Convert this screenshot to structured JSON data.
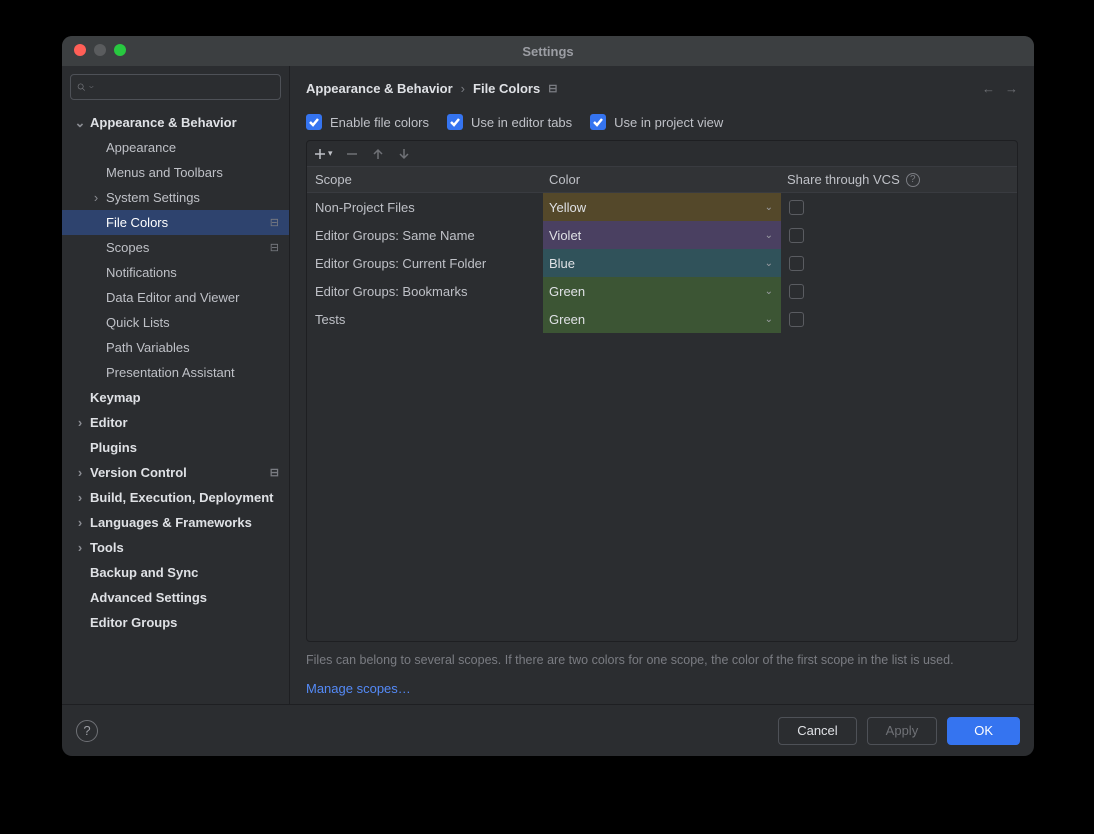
{
  "window": {
    "title": "Settings"
  },
  "search": {
    "placeholder": ""
  },
  "sidebar": [
    {
      "label": "Appearance & Behavior",
      "level": 0,
      "expandable": true,
      "expanded": true,
      "bold": true
    },
    {
      "label": "Appearance",
      "level": 1
    },
    {
      "label": "Menus and Toolbars",
      "level": 1
    },
    {
      "label": "System Settings",
      "level": 1,
      "expandable": true,
      "expanded": false
    },
    {
      "label": "File Colors",
      "level": 1,
      "selected": true,
      "badge": true
    },
    {
      "label": "Scopes",
      "level": 1,
      "badge": true
    },
    {
      "label": "Notifications",
      "level": 1
    },
    {
      "label": "Data Editor and Viewer",
      "level": 1
    },
    {
      "label": "Quick Lists",
      "level": 1
    },
    {
      "label": "Path Variables",
      "level": 1
    },
    {
      "label": "Presentation Assistant",
      "level": 1
    },
    {
      "label": "Keymap",
      "level": 0,
      "bold": true,
      "leaf": true
    },
    {
      "label": "Editor",
      "level": 0,
      "expandable": true,
      "bold": true
    },
    {
      "label": "Plugins",
      "level": 0,
      "bold": true,
      "leaf": true
    },
    {
      "label": "Version Control",
      "level": 0,
      "expandable": true,
      "bold": true,
      "badge": true
    },
    {
      "label": "Build, Execution, Deployment",
      "level": 0,
      "expandable": true,
      "bold": true
    },
    {
      "label": "Languages & Frameworks",
      "level": 0,
      "expandable": true,
      "bold": true
    },
    {
      "label": "Tools",
      "level": 0,
      "expandable": true,
      "bold": true
    },
    {
      "label": "Backup and Sync",
      "level": 0,
      "bold": true,
      "leaf": true
    },
    {
      "label": "Advanced Settings",
      "level": 0,
      "bold": true,
      "leaf": true
    },
    {
      "label": "Editor Groups",
      "level": 0,
      "bold": true,
      "leaf": true
    }
  ],
  "breadcrumb": {
    "parent": "Appearance & Behavior",
    "current": "File Colors"
  },
  "checks": {
    "enable": "Enable file colors",
    "tabs": "Use in editor tabs",
    "project": "Use in project view"
  },
  "table": {
    "headers": {
      "scope": "Scope",
      "color": "Color",
      "vcs": "Share through VCS"
    },
    "rows": [
      {
        "scope": "Non-Project Files",
        "color": "Yellow",
        "bg": "#54482a"
      },
      {
        "scope": "Editor Groups: Same Name",
        "color": "Violet",
        "bg": "#4a4061"
      },
      {
        "scope": "Editor Groups: Current Folder",
        "color": "Blue",
        "bg": "#30525a"
      },
      {
        "scope": "Editor Groups: Bookmarks",
        "color": "Green",
        "bg": "#3c5534"
      },
      {
        "scope": "Tests",
        "color": "Green",
        "bg": "#3c5534"
      }
    ]
  },
  "hint": "Files can belong to several scopes. If there are two colors for one scope, the color of the first scope in the list is used.",
  "link": "Manage scopes…",
  "buttons": {
    "cancel": "Cancel",
    "apply": "Apply",
    "ok": "OK"
  }
}
